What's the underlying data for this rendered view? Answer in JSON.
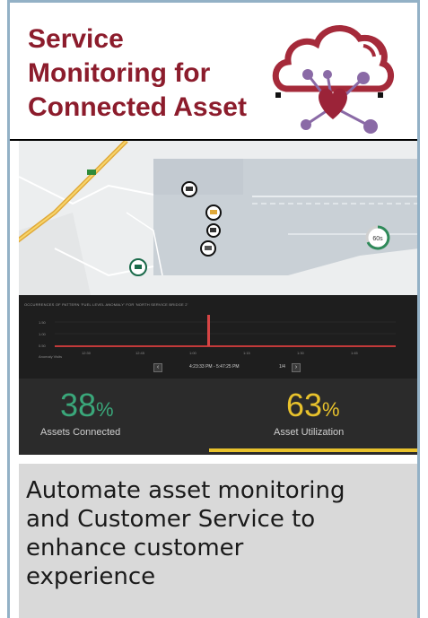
{
  "header": {
    "title_lines": [
      "Service",
      "Monitoring for",
      "Connected Asset"
    ],
    "logo": "cloud-heart-network-icon",
    "colors": {
      "title": "#8c1c2c",
      "cloud": "#a52a3a",
      "border": "#93b1c6"
    }
  },
  "map": {
    "marker_icons": [
      "map-pin-icon",
      "map-pin-icon",
      "map-pin-icon",
      "map-pin-icon",
      "map-pin-icon"
    ],
    "badge_label": "60s"
  },
  "dashboard": {
    "chart": {
      "title": "OCCURRENCES OF PATTERN 'FUEL LEVEL ANOMALY' FOR 'NORTH SERVICE BRIDGE 2'",
      "y_ticks": [
        "1.50",
        "1.00",
        "0.50"
      ],
      "x_ticks": [
        "12:30",
        "12:45",
        "1:00",
        "1:15",
        "1:30",
        "1:45"
      ],
      "legend": "Anomaly Visits"
    },
    "pager": {
      "prev_icon": "chevron-left-icon",
      "range": "4:23:33 PM - 5:47:25 PM",
      "count": "1/4",
      "next_icon": "chevron-right-icon"
    },
    "stats": [
      {
        "value": "38",
        "unit": "%",
        "label": "Assets Connected",
        "color": "#3aa77a"
      },
      {
        "value": "63",
        "unit": "%",
        "label": "Asset Utilization",
        "color": "#e8c22c"
      }
    ]
  },
  "footer": {
    "lines": [
      "Automate asset monitoring",
      "and Customer Service to",
      "enhance customer",
      "experience"
    ]
  }
}
